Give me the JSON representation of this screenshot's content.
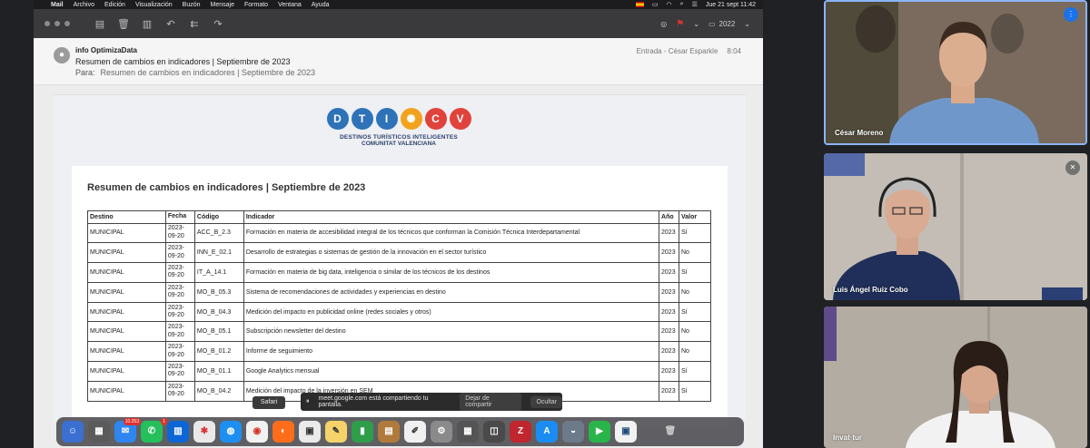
{
  "menubar": {
    "app": "Mail",
    "menus": [
      "Archivo",
      "Edición",
      "Visualización",
      "Buzón",
      "Mensaje",
      "Formato",
      "Ventana",
      "Ayuda"
    ],
    "datetime": "Jue 21 sept  11:42"
  },
  "toolbar": {
    "folder": "2022"
  },
  "email": {
    "sender": "info OptimizaData",
    "subject": "Resumen de cambios en indicadores | Septiembre de 2023",
    "to_label": "Para:",
    "to_value": "Resumen de cambios en indicadores | Septiembre de 2023",
    "mailbox": "Entrada - César Esparkle",
    "time": "8:04"
  },
  "logo": {
    "letters": [
      "D",
      "T",
      "I",
      "",
      "C",
      "V"
    ],
    "line1": "DESTINOS TURÍSTICOS INTELIGENTES",
    "line2": "COMUNITAT VALENCIANA"
  },
  "card": {
    "title": "Resumen de cambios en indicadores | Septiembre de 2023"
  },
  "table": {
    "headers": [
      "Destino",
      "Fecha",
      "Código",
      "Indicador",
      "Año",
      "Valor"
    ],
    "rows": [
      [
        "MUNICIPAL",
        "2023-09-20",
        "ACC_B_2.3",
        "Formación en materia de accesibilidad integral de los técnicos que conforman la Comisión Técnica Interdepartamental",
        "2023",
        "Sí"
      ],
      [
        "MUNICIPAL",
        "2023-09-20",
        "INN_E_02.1",
        "Desarrollo de estrategias o sistemas de gestión de la innovación en el sector turístico",
        "2023",
        "No"
      ],
      [
        "MUNICIPAL",
        "2023-09-20",
        "IT_A_14.1",
        "Formación en materia de big data, inteligencia o similar de los técnicos de los destinos",
        "2023",
        "Sí"
      ],
      [
        "MUNICIPAL",
        "2023-09-20",
        "MO_B_05.3",
        "Sistema de recomendaciones de actividades y experiencias en destino",
        "2023",
        "No"
      ],
      [
        "MUNICIPAL",
        "2023-09-20",
        "MO_B_04.3",
        "Medición del impacto en publicidad online (redes sociales y otros)",
        "2023",
        "Sí"
      ],
      [
        "MUNICIPAL",
        "2023-09-20",
        "MO_B_05.1",
        "Subscripción newsletter del destino",
        "2023",
        "No"
      ],
      [
        "MUNICIPAL",
        "2023-09-20",
        "MO_B_01.2",
        "Informe de seguimiento",
        "2023",
        "No"
      ],
      [
        "MUNICIPAL",
        "2023-09-20",
        "MO_B_01.1",
        "Google Analytics mensual",
        "2023",
        "Sí"
      ],
      [
        "MUNICIPAL",
        "2023-09-20",
        "MO_B_04.2",
        "Medición del impacto de la inversión en SEM",
        "2023",
        "Sí"
      ]
    ]
  },
  "share_bar": {
    "message": "meet.google.com está compartiendo tu pantalla.",
    "stop_label": "Dejar de compartir",
    "hide_label": "Ocultar"
  },
  "dock": {
    "tooltip": "Safari",
    "mail_badge": "10.253",
    "whatsapp_badge": "1"
  },
  "participants": [
    {
      "name": "César Moreno"
    },
    {
      "name": "Luis Ángel Ruiz Cobo"
    },
    {
      "name": "Invat·tur"
    }
  ]
}
